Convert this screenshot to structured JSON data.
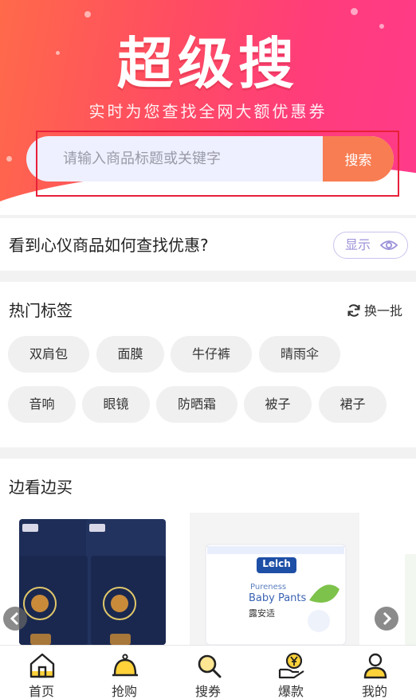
{
  "hero": {
    "title": "超级搜",
    "subtitle": "实时为您查找全网大额优惠券"
  },
  "search": {
    "placeholder": "请输入商品标题或关键字",
    "value": "",
    "button_label": "搜索"
  },
  "info": {
    "question": "看到心仪商品如何查找优惠?",
    "show_label": "显示"
  },
  "hot_tags": {
    "title": "热门标签",
    "refresh_label": "换一批",
    "tags": [
      "双肩包",
      "面膜",
      "牛仔裤",
      "晴雨伞",
      "音响",
      "眼镜",
      "防晒霜",
      "被子",
      "裙子"
    ]
  },
  "watch_buy": {
    "title": "边看边买",
    "product2_brand": "Lelch",
    "product2_line1": "Pureness",
    "product2_line2": "Baby Pants",
    "product2_cn": "露安适"
  },
  "tabbar": {
    "items": [
      {
        "label": "首页",
        "icon": "home-icon"
      },
      {
        "label": "抢购",
        "icon": "bell-icon"
      },
      {
        "label": "搜券",
        "icon": "search-icon"
      },
      {
        "label": "爆款",
        "icon": "money-hand-icon"
      },
      {
        "label": "我的",
        "icon": "user-icon"
      }
    ]
  },
  "colors": {
    "accent": "#f87d52",
    "hero_start": "#ff6a4a",
    "hero_end": "#ff3a8a",
    "tab_icon_yellow": "#ffd23a",
    "highlight": "#e8203a"
  }
}
